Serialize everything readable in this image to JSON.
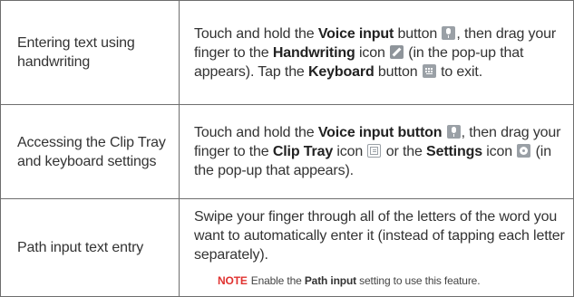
{
  "rows": [
    {
      "label": "Entering text using handwriting",
      "t1": "Touch and hold the ",
      "voice_input": "Voice input",
      "t2": " button ",
      "t3": ", then drag your finger to the ",
      "handwriting": "Handwriting",
      "t4": " icon ",
      "t5": " (in the pop-up that appears). Tap the ",
      "keyboard": "Keyboard",
      "t6": " button ",
      "t7": " to exit.",
      "icons": [
        "microphone-icon",
        "pen-icon",
        "keyboard-icon"
      ]
    },
    {
      "label": "Accessing the Clip Tray and keyboard settings",
      "t1": "Touch and hold the ",
      "voice_input_button": "Voice input button",
      "t2": " ",
      "t3": ", then drag your finger to the ",
      "clip_tray": "Clip Tray",
      "t4": " icon ",
      "t5": " or the ",
      "settings": "Settings",
      "t6": " icon ",
      "t7": " (in the pop-up that appears).",
      "icons": [
        "microphone-icon",
        "clip-tray-icon",
        "gear-icon"
      ]
    },
    {
      "label": "Path input text entry",
      "text": "Swipe your finger through all of the letters of the word you want to automatically enter it (instead of tapping each letter separately).",
      "note": {
        "keyword": "NOTE",
        "t1": "Enable the ",
        "path_input": "Path input",
        "t2": " setting to use this feature."
      }
    }
  ],
  "colors": {
    "border": "#6e6e6e",
    "note_keyword": "#e0312f",
    "icon_gray": "#9aa0a6"
  }
}
